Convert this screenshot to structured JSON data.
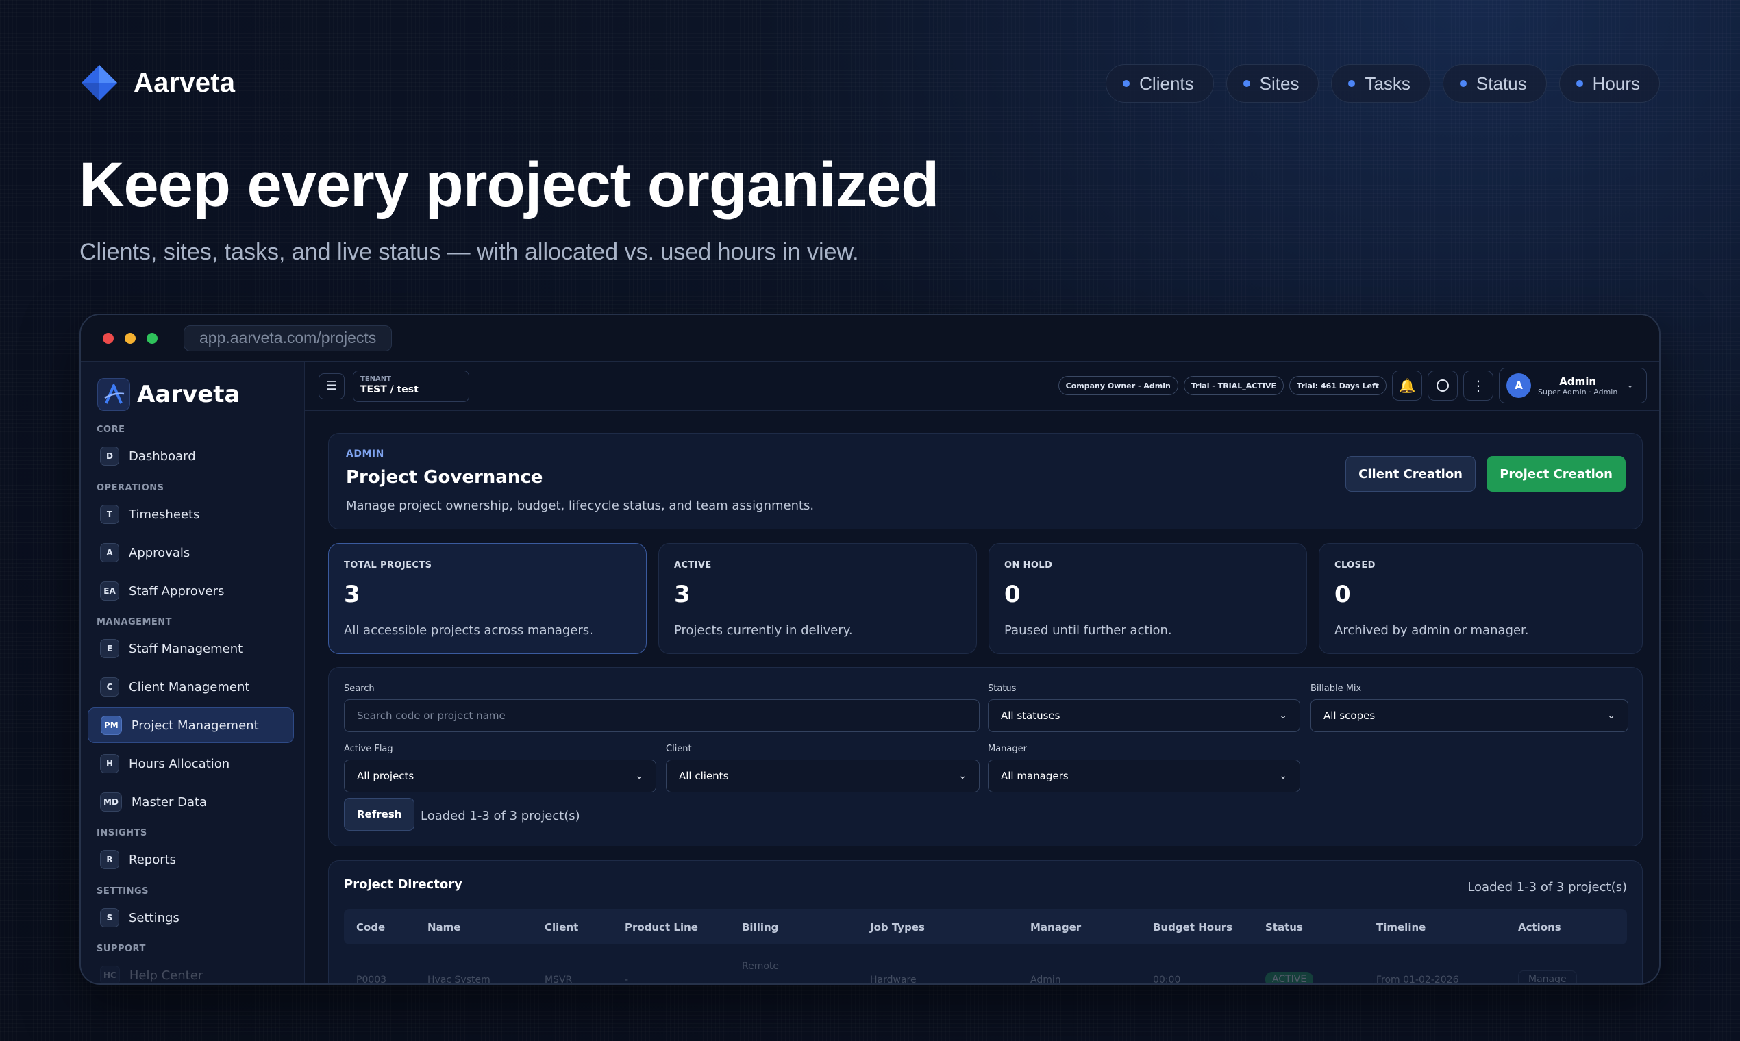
{
  "hero": {
    "brand": "Aarveta",
    "nav_pills": [
      "Clients",
      "Sites",
      "Tasks",
      "Status",
      "Hours"
    ],
    "title": "Keep every project organized",
    "subtitle": "Clients, sites, tasks, and live status — with allocated vs. used hours in view."
  },
  "browser": {
    "url": "app.aarveta.com/projects"
  },
  "sidebar": {
    "brand": "Aarveta",
    "sections": {
      "core": "CORE",
      "operations": "OPERATIONS",
      "management": "MANAGEMENT",
      "insights": "INSIGHTS",
      "settings": "SETTINGS",
      "support": "SUPPORT"
    },
    "items": [
      {
        "badge": "D",
        "label": "Dashboard"
      },
      {
        "badge": "T",
        "label": "Timesheets"
      },
      {
        "badge": "A",
        "label": "Approvals"
      },
      {
        "badge": "EA",
        "label": "Staff Approvers"
      },
      {
        "badge": "E",
        "label": "Staff Management"
      },
      {
        "badge": "C",
        "label": "Client Management"
      },
      {
        "badge": "PM",
        "label": "Project Management"
      },
      {
        "badge": "H",
        "label": "Hours Allocation"
      },
      {
        "badge": "MD",
        "label": "Master Data"
      },
      {
        "badge": "R",
        "label": "Reports"
      },
      {
        "badge": "S",
        "label": "Settings"
      },
      {
        "badge": "HC",
        "label": "Help Center"
      }
    ],
    "active_index": 6
  },
  "topbar": {
    "tenant_label": "TENANT",
    "tenant_value": "TEST / test",
    "chips": [
      "Company Owner - Admin",
      "Trial - TRIAL_ACTIVE",
      "Trial: 461 Days Left"
    ],
    "user_initial": "A",
    "user_name": "Admin",
    "user_role": "Super Admin · Admin"
  },
  "governance": {
    "eyebrow": "ADMIN",
    "title": "Project Governance",
    "description": "Manage project ownership, budget, lifecycle status, and team assignments.",
    "client_button": "Client Creation",
    "project_button": "Project Creation"
  },
  "stats": [
    {
      "label": "TOTAL PROJECTS",
      "value": "3",
      "desc": "All accessible projects across managers."
    },
    {
      "label": "ACTIVE",
      "value": "3",
      "desc": "Projects currently in delivery."
    },
    {
      "label": "ON HOLD",
      "value": "0",
      "desc": "Paused until further action."
    },
    {
      "label": "CLOSED",
      "value": "0",
      "desc": "Archived by admin or manager."
    }
  ],
  "filters": {
    "search_label": "Search",
    "search_placeholder": "Search code or project name",
    "status_label": "Status",
    "status_value": "All statuses",
    "billable_label": "Billable Mix",
    "billable_value": "All scopes",
    "active_label": "Active Flag",
    "active_value": "All projects",
    "client_label": "Client",
    "client_value": "All clients",
    "manager_label": "Manager",
    "manager_value": "All managers",
    "refresh": "Refresh",
    "loaded": "Loaded 1-3 of 3 project(s)"
  },
  "directory": {
    "title": "Project Directory",
    "count": "Loaded 1-3 of 3 project(s)",
    "columns": [
      "Code",
      "Name",
      "Client",
      "Product Line",
      "Billing",
      "Job Types",
      "Manager",
      "Budget Hours",
      "Status",
      "Timeline",
      "Actions"
    ],
    "rows": [
      {
        "code": "P0003",
        "name": "Hvac System",
        "client": "MSVR",
        "product_line": "-",
        "billing": "Remote",
        "job_types": "Hardware",
        "manager": "Admin",
        "budget": "00:00",
        "status": "ACTIVE",
        "timeline": "From 01-02-2026",
        "action": "Manage"
      }
    ]
  },
  "colors": {
    "accent_blue": "#4d86f7",
    "success_green": "#1f9b54",
    "traffic_red": "#ee4b4b",
    "traffic_yellow": "#f5b131",
    "traffic_green": "#2fc25b"
  }
}
